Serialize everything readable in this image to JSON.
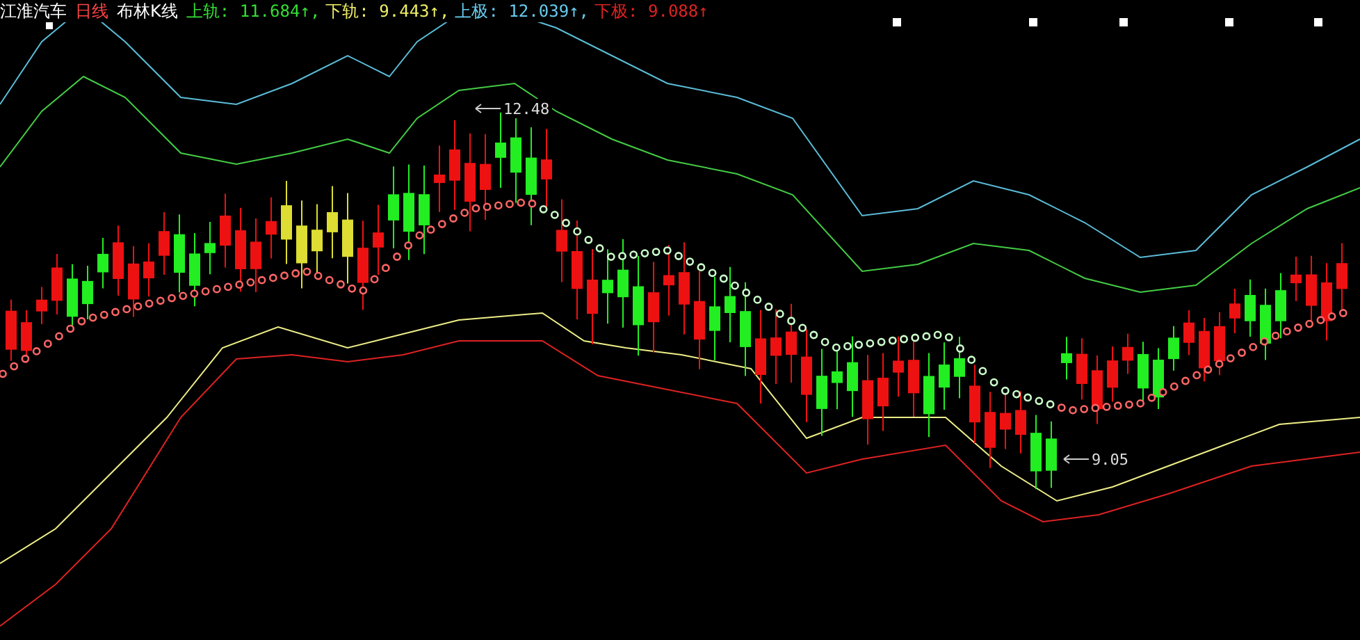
{
  "header": {
    "stock_name": "江淮汽车",
    "period": "日线",
    "indicator_name": "布林K线",
    "indicators": [
      {
        "label": "上轨:",
        "value": "11.684",
        "arrow": "↑",
        "separator": ",",
        "color": "#33dd33"
      },
      {
        "label": "下轨:",
        "value": "9.443",
        "arrow": "↑",
        "separator": ",",
        "color": "#eeee66"
      },
      {
        "label": "上极:",
        "value": "12.039",
        "arrow": "↑",
        "separator": ",",
        "color": "#66ccee"
      },
      {
        "label": "下极:",
        "value": "9.088",
        "arrow": "↑",
        "color": "#dd2222"
      }
    ]
  },
  "annotations": [
    {
      "kind": "high",
      "text": "12.48"
    },
    {
      "kind": "low",
      "text": "9.05"
    }
  ]
}
